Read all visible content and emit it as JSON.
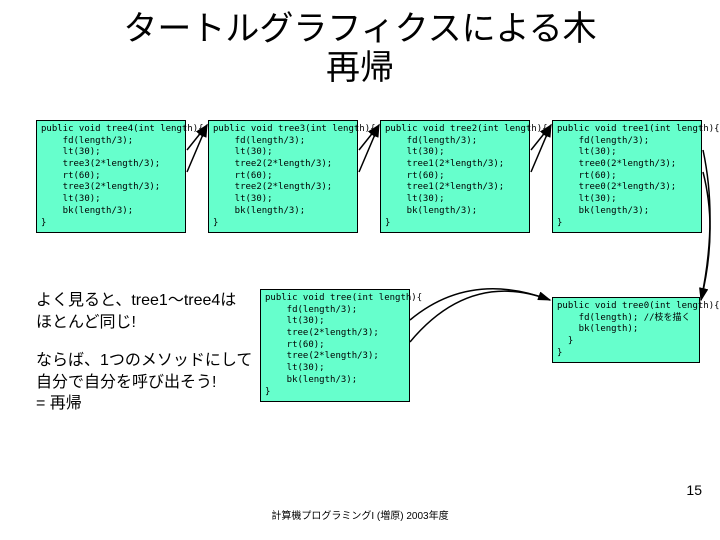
{
  "title_line1": "タートルグラフィクスによる木",
  "title_line2": "再帰",
  "code": {
    "tree4": "public void tree4(int length){\n    fd(length/3);\n    lt(30);\n    tree3(2*length/3);\n    rt(60);\n    tree3(2*length/3);\n    lt(30);\n    bk(length/3);\n}",
    "tree3": "public void tree3(int length){\n    fd(length/3);\n    lt(30);\n    tree2(2*length/3);\n    rt(60);\n    tree2(2*length/3);\n    lt(30);\n    bk(length/3);\n}",
    "tree2": "public void tree2(int length){\n    fd(length/3);\n    lt(30);\n    tree1(2*length/3);\n    rt(60);\n    tree1(2*length/3);\n    lt(30);\n    bk(length/3);\n}",
    "tree1": "public void tree1(int length){\n    fd(length/3);\n    lt(30);\n    tree0(2*length/3);\n    rt(60);\n    tree0(2*length/3);\n    lt(30);\n    bk(length/3);\n}",
    "tree": "public void tree(int length){\n    fd(length/3);\n    lt(30);\n    tree(2*length/3);\n    rt(60);\n    tree(2*length/3);\n    lt(30);\n    bk(length/3);\n}",
    "tree0": "public void tree0(int length){\n    fd(length); //枝を描く\n    bk(length);\n  }\n}"
  },
  "note1": "よく見ると、tree1～tree4は\nほとんど同じ!",
  "note2": "ならば、1つのメソッドにして\n自分で自分を呼び出そう!\n= 再帰",
  "pagenum": "15",
  "footer": "計算機プログラミングI (増原) 2003年度"
}
